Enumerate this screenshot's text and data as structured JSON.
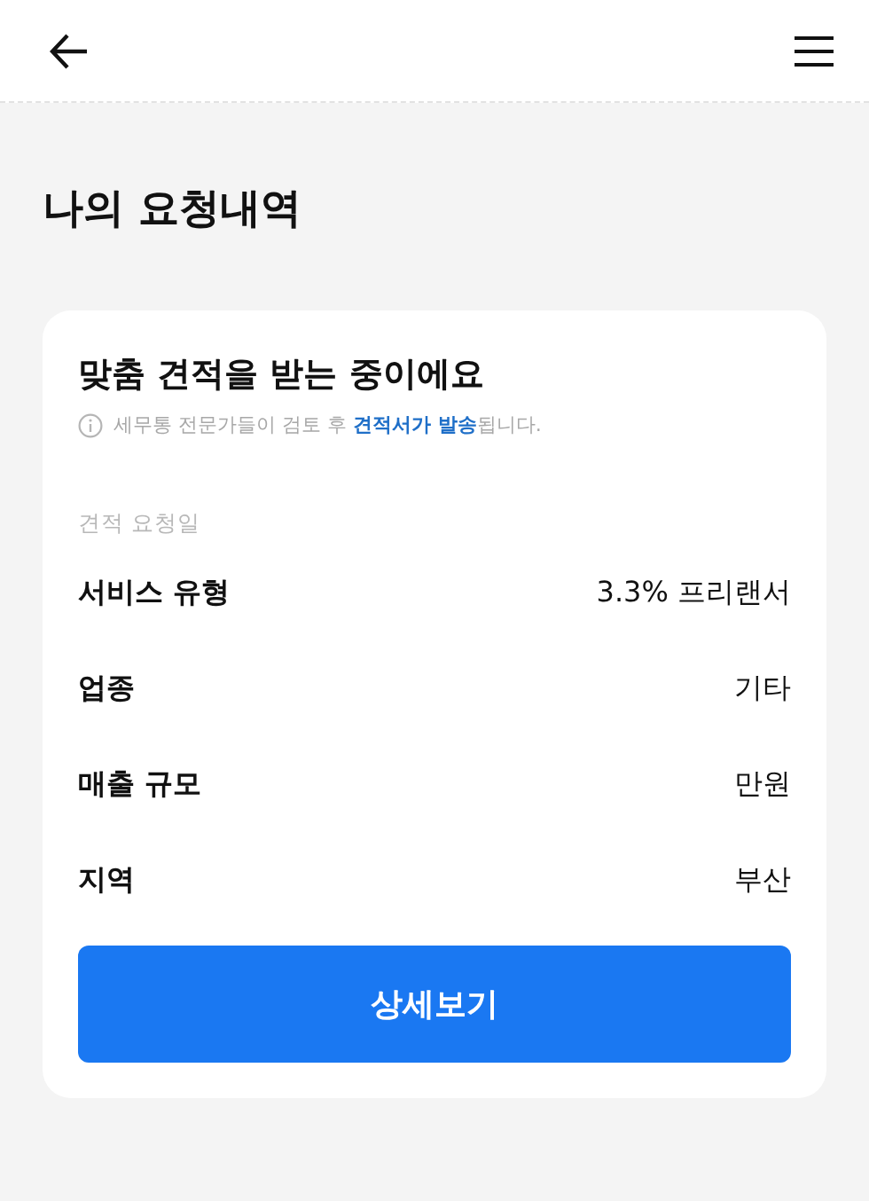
{
  "page_title": "나의 요청내역",
  "card": {
    "heading": "맞춤 견적을 받는 중이에요",
    "note": "세무통 전문가들이 검토 후 **견적서가 발송**됩니다.",
    "date_label": "견적 요청일",
    "rows": [
      {
        "label": "서비스 유형",
        "value": "3.3% 프리랜서"
      },
      {
        "label": "업종",
        "value": "기타"
      },
      {
        "label": "매출 규모",
        "value": "만원"
      },
      {
        "label": "지역",
        "value": "부산"
      }
    ],
    "button": "상세보기"
  }
}
